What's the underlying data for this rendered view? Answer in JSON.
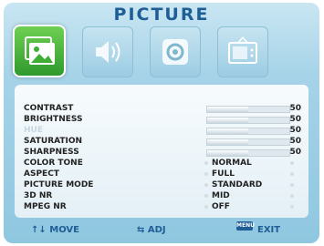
{
  "menu": {
    "title": "PICTURE",
    "tabs": [
      {
        "icon": "picture-icon",
        "active": true
      },
      {
        "icon": "speaker-icon",
        "active": false
      },
      {
        "icon": "gear-icon",
        "active": false
      },
      {
        "icon": "tv-icon",
        "active": false
      }
    ],
    "items": [
      {
        "label": "CONTRAST",
        "type": "slider",
        "value": "50",
        "level": 0.5
      },
      {
        "label": "BRIGHTNESS",
        "type": "slider",
        "value": "50",
        "level": 0.5
      },
      {
        "label": "HUE",
        "type": "slider",
        "value": "50",
        "level": 0.5,
        "disabled": true
      },
      {
        "label": "SATURATION",
        "type": "slider",
        "value": "50",
        "level": 0.5
      },
      {
        "label": "SHARPNESS",
        "type": "slider",
        "value": "50",
        "level": 0.5
      },
      {
        "label": "COLOR TONE",
        "type": "option",
        "value": "NORMAL"
      },
      {
        "label": "ASPECT",
        "type": "option",
        "value": "FULL"
      },
      {
        "label": "PICTURE MODE",
        "type": "option",
        "value": "STANDARD"
      },
      {
        "label": "3D NR",
        "type": "option",
        "value": "MID"
      },
      {
        "label": "MPEG NR",
        "type": "option",
        "value": "OFF"
      }
    ]
  },
  "footer": {
    "move": "↑↓ MOVE",
    "adjust": "⇆ ADJ",
    "menu_badge": "MENU",
    "exit": "EXIT"
  },
  "colors": {
    "title": "#1f5d95",
    "active_tab": "#3fae35",
    "panel": "#f2f8fb"
  }
}
